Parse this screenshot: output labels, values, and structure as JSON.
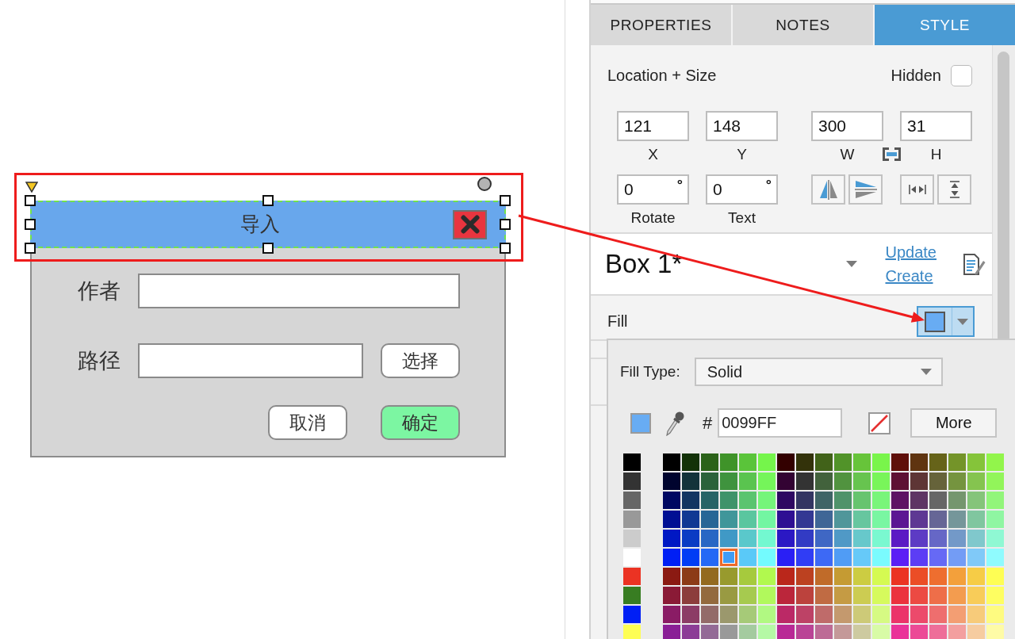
{
  "canvas": {
    "dialog": {
      "title": "导入",
      "selected": true,
      "fields": [
        {
          "kind": "text",
          "label": "作者"
        },
        {
          "kind": "browse",
          "label": "路径",
          "button": "选择"
        }
      ],
      "buttons": [
        {
          "label": "取消",
          "primary": false
        },
        {
          "label": "确定",
          "primary": true
        }
      ]
    },
    "annotation": {
      "frame": true,
      "arrow": true
    }
  },
  "panel": {
    "tabs": [
      {
        "label": "PROPERTIES",
        "selected": false
      },
      {
        "label": "NOTES",
        "selected": false
      },
      {
        "label": "STYLE",
        "selected": true
      }
    ],
    "location_size": {
      "title": "Location + Size",
      "hidden_label": "Hidden",
      "hidden": false,
      "fields": [
        {
          "label": "X",
          "value": "121"
        },
        {
          "label": "Y",
          "value": "148"
        },
        {
          "label": "W",
          "value": "300"
        },
        {
          "label": "H",
          "value": "31"
        }
      ],
      "angles": [
        {
          "label": "Rotate",
          "value": "0",
          "unit": "°"
        },
        {
          "label": "Text",
          "value": "0",
          "unit": "°"
        }
      ]
    },
    "symbol": {
      "name": "Box 1*",
      "links": [
        "Update",
        "Create"
      ]
    },
    "fill": {
      "label": "Fill",
      "open": true
    },
    "fill_popup": {
      "type_label": "Fill Type:",
      "type": "Solid",
      "hash": "#",
      "hex": "0099FF",
      "more": "More",
      "basic": [
        {
          "color": "#000000",
          "selected": false
        },
        {
          "color": "#333333",
          "selected": false
        },
        {
          "color": "#666666",
          "selected": false
        },
        {
          "color": "#999999",
          "selected": false
        },
        {
          "color": "#cccccc",
          "selected": false
        },
        {
          "color": "#ffffff",
          "selected": false
        },
        {
          "color": "#eb3323",
          "selected": false
        },
        {
          "color": "#387d22",
          "selected": false
        },
        {
          "color": "#001ff5",
          "selected": false
        },
        {
          "color": "#fefe54",
          "selected": false
        }
      ],
      "grid": [
        {
          "swatches": [
            {
              "color": "#000000",
              "selected": false
            },
            {
              "color": "#133208",
              "selected": false
            },
            {
              "color": "#2b6219",
              "selected": false
            },
            {
              "color": "#3f9329",
              "selected": false
            },
            {
              "color": "#5ac43a",
              "selected": false
            },
            {
              "color": "#75f54b",
              "selected": false
            },
            {
              "color": "#330000",
              "selected": false
            },
            {
              "color": "#33320a",
              "selected": false
            },
            {
              "color": "#416219",
              "selected": false
            },
            {
              "color": "#519329",
              "selected": false
            },
            {
              "color": "#67c43a",
              "selected": false
            },
            {
              "color": "#79f54b",
              "selected": false
            },
            {
              "color": "#5f0f0a",
              "selected": false
            },
            {
              "color": "#5f3410",
              "selected": false
            },
            {
              "color": "#666319",
              "selected": false
            },
            {
              "color": "#749429",
              "selected": false
            },
            {
              "color": "#85c43a",
              "selected": false
            },
            {
              "color": "#92f54b",
              "selected": false
            }
          ]
        },
        {
          "swatches": [
            {
              "color": "#00042e",
              "selected": false
            },
            {
              "color": "#13333a",
              "selected": false
            },
            {
              "color": "#2b623a",
              "selected": false
            },
            {
              "color": "#3f933e",
              "selected": false
            },
            {
              "color": "#5ac44f",
              "selected": false
            },
            {
              "color": "#75f55a",
              "selected": false
            },
            {
              "color": "#330333",
              "selected": false
            },
            {
              "color": "#333333",
              "selected": false
            },
            {
              "color": "#42623c",
              "selected": false
            },
            {
              "color": "#51933f",
              "selected": false
            },
            {
              "color": "#67c44f",
              "selected": false
            },
            {
              "color": "#79f55a",
              "selected": false
            },
            {
              "color": "#5e1034",
              "selected": false
            },
            {
              "color": "#5e3535",
              "selected": false
            },
            {
              "color": "#66633a",
              "selected": false
            },
            {
              "color": "#75943f",
              "selected": false
            },
            {
              "color": "#85c44f",
              "selected": false
            },
            {
              "color": "#92f55a",
              "selected": false
            }
          ]
        },
        {
          "swatches": [
            {
              "color": "#000862",
              "selected": false
            },
            {
              "color": "#133562",
              "selected": false
            },
            {
              "color": "#276466",
              "selected": false
            },
            {
              "color": "#3f936a",
              "selected": false
            },
            {
              "color": "#5ac46f",
              "selected": false
            },
            {
              "color": "#75f57a",
              "selected": false
            },
            {
              "color": "#2e0862",
              "selected": false
            },
            {
              "color": "#333562",
              "selected": false
            },
            {
              "color": "#3f6466",
              "selected": false
            },
            {
              "color": "#4f936a",
              "selected": false
            },
            {
              "color": "#67c46f",
              "selected": false
            },
            {
              "color": "#79f57a",
              "selected": false
            },
            {
              "color": "#5e1364",
              "selected": false
            },
            {
              "color": "#5e3564",
              "selected": false
            },
            {
              "color": "#666666",
              "selected": false
            },
            {
              "color": "#75966e",
              "selected": false
            },
            {
              "color": "#85c47a",
              "selected": false
            },
            {
              "color": "#92f57a",
              "selected": false
            }
          ]
        },
        {
          "swatches": [
            {
              "color": "#000f93",
              "selected": false
            },
            {
              "color": "#103893",
              "selected": false
            },
            {
              "color": "#276696",
              "selected": false
            },
            {
              "color": "#40969a",
              "selected": false
            },
            {
              "color": "#5ac69f",
              "selected": false
            },
            {
              "color": "#73f6a2",
              "selected": false
            },
            {
              "color": "#2e0f93",
              "selected": false
            },
            {
              "color": "#333893",
              "selected": false
            },
            {
              "color": "#3f6696",
              "selected": false
            },
            {
              "color": "#50969a",
              "selected": false
            },
            {
              "color": "#67c69f",
              "selected": false
            },
            {
              "color": "#79f6a2",
              "selected": false
            },
            {
              "color": "#5c1693",
              "selected": false
            },
            {
              "color": "#5e3893",
              "selected": false
            },
            {
              "color": "#666696",
              "selected": false
            },
            {
              "color": "#75969a",
              "selected": false
            },
            {
              "color": "#80c69f",
              "selected": false
            },
            {
              "color": "#8ff6a2",
              "selected": false
            }
          ]
        },
        {
          "swatches": [
            {
              "color": "#0018c4",
              "selected": false
            },
            {
              "color": "#0a3bc4",
              "selected": false
            },
            {
              "color": "#2867c4",
              "selected": false
            },
            {
              "color": "#4099c6",
              "selected": false
            },
            {
              "color": "#5ac8cb",
              "selected": false
            },
            {
              "color": "#73f8d0",
              "selected": false
            },
            {
              "color": "#2b18c4",
              "selected": false
            },
            {
              "color": "#323bc4",
              "selected": false
            },
            {
              "color": "#3f67c4",
              "selected": false
            },
            {
              "color": "#5099c6",
              "selected": false
            },
            {
              "color": "#67c8cb",
              "selected": false
            },
            {
              "color": "#7af8d0",
              "selected": false
            },
            {
              "color": "#5c1ac4",
              "selected": false
            },
            {
              "color": "#5d3bc4",
              "selected": false
            },
            {
              "color": "#6667c6",
              "selected": false
            },
            {
              "color": "#7399c8",
              "selected": false
            },
            {
              "color": "#80c8cc",
              "selected": false
            },
            {
              "color": "#8ff8d3",
              "selected": false
            }
          ]
        },
        {
          "swatches": [
            {
              "color": "#001ff5",
              "selected": false
            },
            {
              "color": "#003df5",
              "selected": false
            },
            {
              "color": "#2469f5",
              "selected": false
            },
            {
              "color": "#409cf5",
              "selected": true
            },
            {
              "color": "#5ac9f8",
              "selected": false
            },
            {
              "color": "#73fbfe",
              "selected": false
            },
            {
              "color": "#2a1ff5",
              "selected": false
            },
            {
              "color": "#303df5",
              "selected": false
            },
            {
              "color": "#3d69f5",
              "selected": false
            },
            {
              "color": "#509cf5",
              "selected": false
            },
            {
              "color": "#66c9f8",
              "selected": false
            },
            {
              "color": "#7afbfe",
              "selected": false
            },
            {
              "color": "#5c1ff5",
              "selected": false
            },
            {
              "color": "#5c3df5",
              "selected": false
            },
            {
              "color": "#6669f5",
              "selected": false
            },
            {
              "color": "#739cf5",
              "selected": false
            },
            {
              "color": "#80c9f8",
              "selected": false
            },
            {
              "color": "#8ffbfe",
              "selected": false
            }
          ]
        },
        {
          "swatches": [
            {
              "color": "#8b1a12",
              "selected": false
            },
            {
              "color": "#8c3b17",
              "selected": false
            },
            {
              "color": "#936a1f",
              "selected": false
            },
            {
              "color": "#989a2d",
              "selected": false
            },
            {
              "color": "#a6ca3d",
              "selected": false
            },
            {
              "color": "#b1f94e",
              "selected": false
            },
            {
              "color": "#ba271b",
              "selected": false
            },
            {
              "color": "#bc4120",
              "selected": false
            },
            {
              "color": "#c06b29",
              "selected": false
            },
            {
              "color": "#c59b33",
              "selected": false
            },
            {
              "color": "#cccc42",
              "selected": false
            },
            {
              "color": "#d5fa52",
              "selected": false
            },
            {
              "color": "#eb3323",
              "selected": false
            },
            {
              "color": "#eb4d26",
              "selected": false
            },
            {
              "color": "#ee6e2f",
              "selected": false
            },
            {
              "color": "#f3a03b",
              "selected": false
            },
            {
              "color": "#f6cc46",
              "selected": false
            },
            {
              "color": "#fefe54",
              "selected": false
            }
          ]
        },
        {
          "swatches": [
            {
              "color": "#8a1a36",
              "selected": false
            },
            {
              "color": "#8c3d3c",
              "selected": false
            },
            {
              "color": "#936a3e",
              "selected": false
            },
            {
              "color": "#999a42",
              "selected": false
            },
            {
              "color": "#a6ca4f",
              "selected": false
            },
            {
              "color": "#b1f95c",
              "selected": false
            },
            {
              "color": "#bb263b",
              "selected": false
            },
            {
              "color": "#bc423d",
              "selected": false
            },
            {
              "color": "#c06b43",
              "selected": false
            },
            {
              "color": "#c59b44",
              "selected": false
            },
            {
              "color": "#cccc52",
              "selected": false
            },
            {
              "color": "#d6fa5d",
              "selected": false
            },
            {
              "color": "#eb323e",
              "selected": false
            },
            {
              "color": "#ec4a43",
              "selected": false
            },
            {
              "color": "#ee6e49",
              "selected": false
            },
            {
              "color": "#f39c4f",
              "selected": false
            },
            {
              "color": "#f8cc59",
              "selected": false
            },
            {
              "color": "#fefe61",
              "selected": false
            }
          ]
        },
        {
          "swatches": [
            {
              "color": "#8a1c65",
              "selected": false
            },
            {
              "color": "#8c3c66",
              "selected": false
            },
            {
              "color": "#936b69",
              "selected": false
            },
            {
              "color": "#9b986d",
              "selected": false
            },
            {
              "color": "#a6ca78",
              "selected": false
            },
            {
              "color": "#b1f982",
              "selected": false
            },
            {
              "color": "#bb2966",
              "selected": false
            },
            {
              "color": "#bd4266",
              "selected": false
            },
            {
              "color": "#bf6b6a",
              "selected": false
            },
            {
              "color": "#c4996e",
              "selected": false
            },
            {
              "color": "#cdca78",
              "selected": false
            },
            {
              "color": "#d6fa83",
              "selected": false
            },
            {
              "color": "#eb346a",
              "selected": false
            },
            {
              "color": "#ec4a6b",
              "selected": false
            },
            {
              "color": "#ee6e6e",
              "selected": false
            },
            {
              "color": "#f39e73",
              "selected": false
            },
            {
              "color": "#f7cb7a",
              "selected": false
            },
            {
              "color": "#fefb80",
              "selected": false
            }
          ]
        },
        {
          "swatches": [
            {
              "color": "#8a1f96",
              "selected": false
            },
            {
              "color": "#8c3c96",
              "selected": false
            },
            {
              "color": "#936a96",
              "selected": false
            },
            {
              "color": "#999999",
              "selected": false
            },
            {
              "color": "#a4cb9f",
              "selected": false
            },
            {
              "color": "#b5f9a5",
              "selected": false
            },
            {
              "color": "#b92996",
              "selected": false
            },
            {
              "color": "#ba4496",
              "selected": false
            },
            {
              "color": "#bd6b96",
              "selected": false
            },
            {
              "color": "#c49999",
              "selected": false
            },
            {
              "color": "#cdcaa0",
              "selected": false
            },
            {
              "color": "#d8fba6",
              "selected": false
            },
            {
              "color": "#ea3399",
              "selected": false
            },
            {
              "color": "#ec4a96",
              "selected": false
            },
            {
              "color": "#ee6e99",
              "selected": false
            },
            {
              "color": "#f39f9f",
              "selected": false
            },
            {
              "color": "#f6cca0",
              "selected": false
            },
            {
              "color": "#fefba6",
              "selected": false
            }
          ]
        }
      ]
    }
  }
}
